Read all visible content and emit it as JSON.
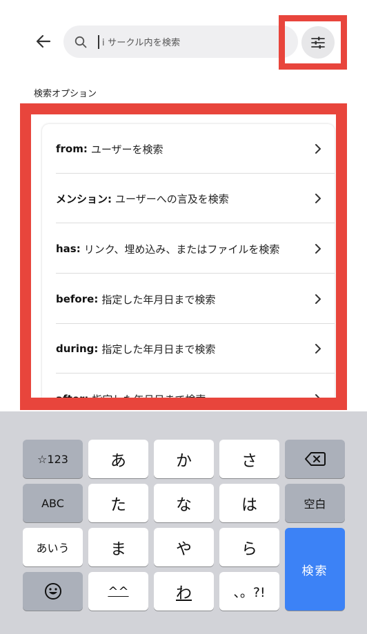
{
  "search": {
    "placeholder": "i サークル内を検索"
  },
  "options_section": {
    "label": "検索オプション",
    "items": [
      {
        "key": "from:",
        "desc": "ユーザーを検索"
      },
      {
        "key": "メンション:",
        "desc": "ユーザーへの言及を検索"
      },
      {
        "key": "has:",
        "desc": "リンク、埋め込み、またはファイルを検索"
      },
      {
        "key": "before:",
        "desc": "指定した年月日まで検索"
      },
      {
        "key": "during:",
        "desc": "指定した年月日まで検索"
      },
      {
        "key": "after:",
        "desc": "指定した年月日まで検索"
      }
    ]
  },
  "keyboard": {
    "mode_key": "☆123",
    "abc_key": "ABC",
    "aiu_key": "あいう",
    "space_key": "空白",
    "search_key": "検索",
    "rows": [
      [
        "あ",
        "か",
        "さ"
      ],
      [
        "た",
        "な",
        "は"
      ],
      [
        "ま",
        "や",
        "ら"
      ],
      [
        "^^",
        "わ",
        "、。?!"
      ]
    ]
  },
  "colors": {
    "highlight": "#e8453c",
    "accent": "#3c82f6",
    "keyboard_bg": "#d2d3d8"
  },
  "icons": {
    "back": "arrow-left-icon",
    "search": "magnifier-icon",
    "filter": "sliders-icon",
    "chevron": "chevron-right-icon",
    "backspace": "backspace-icon",
    "emoji": "emoji-icon"
  }
}
